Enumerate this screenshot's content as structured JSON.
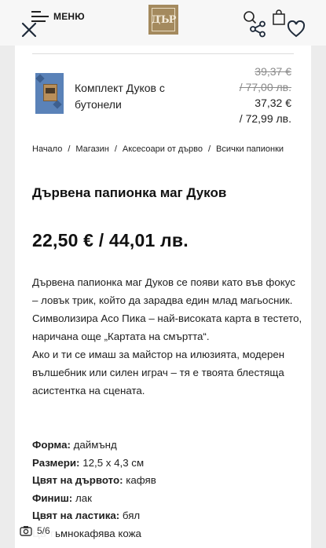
{
  "header": {
    "menu_label": "МЕНЮ",
    "logo_text": "ДЪР",
    "icons": [
      "close-icon",
      "menu-icon",
      "search-icon",
      "bag-icon",
      "share-icon",
      "heart-icon"
    ]
  },
  "bundle": {
    "title": "Комплект Дуков с бутонели",
    "old_price_eur": "39,37 €",
    "old_price_bgn": "/ 77,00 лв.",
    "new_price_eur": "37,32 €",
    "new_price_bgn": "/ 72,99 лв."
  },
  "breadcrumb": {
    "items": [
      "Начало",
      "Магазин",
      "Аксесоари от дърво",
      "Всички папионки"
    ],
    "separator": "/"
  },
  "product": {
    "title": "Дървена папионка маг Дуков",
    "price": "22,50 € / 44,01 лв.",
    "description": [
      "Дървена папионка маг Дуков се появи като във фокус – ловък трик, който да зарадва един млад магьосник. Символизира Асо Пика – най-високата карта в тестето, наричана още „Картата на смъртта“.",
      "Ако и ти се имаш за майстор на илюзията, модерен вълшебник или силен играч – тя е твоята блестяща асистентка на сцената."
    ],
    "specs": [
      {
        "key": "Форма:",
        "value": "даймънд"
      },
      {
        "key": "Размери:",
        "value": "12,5 х 4,3 см"
      },
      {
        "key": "Цвят на дървото:",
        "value": "кафяв"
      },
      {
        "key": "Финиш:",
        "value": "лак"
      },
      {
        "key": "Цвят на ластика:",
        "value": "бял"
      },
      {
        "key": "Цв",
        "value": "тъмнокафява кожа"
      }
    ]
  },
  "gallery": {
    "counter": "5/6"
  },
  "colors": {
    "background": "#ececec",
    "card": "#ffffff",
    "logo": "#a48a5e",
    "text": "#1a1a1a",
    "muted": "#8a8a8a"
  }
}
